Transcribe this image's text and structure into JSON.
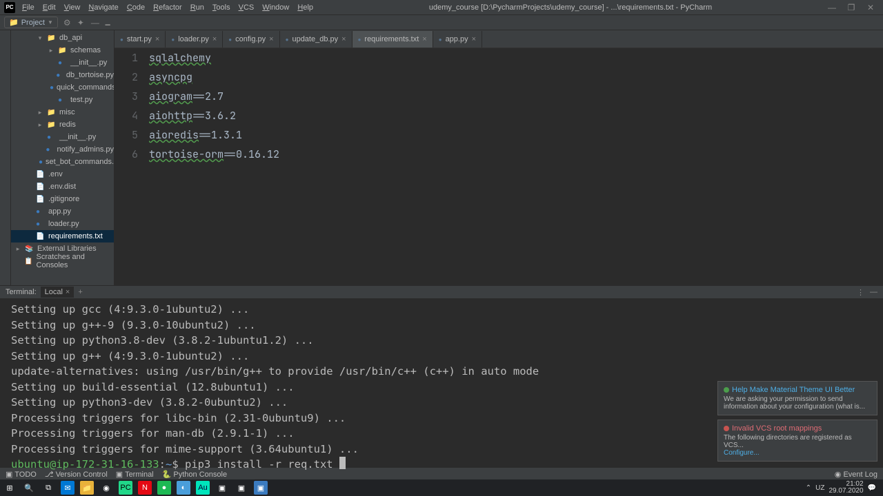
{
  "menu": [
    "File",
    "Edit",
    "View",
    "Navigate",
    "Code",
    "Refactor",
    "Run",
    "Tools",
    "VCS",
    "Window",
    "Help"
  ],
  "window_title": "udemy_course [D:\\PycharmProjects\\udemy_course] - ...\\requirements.txt - PyCharm",
  "project_button": "Project",
  "tabs": [
    {
      "label": "start.py",
      "active": false
    },
    {
      "label": "loader.py",
      "active": false
    },
    {
      "label": "config.py",
      "active": false
    },
    {
      "label": "update_db.py",
      "active": false
    },
    {
      "label": "requirements.txt",
      "active": true
    },
    {
      "label": "app.py",
      "active": false
    }
  ],
  "tree": [
    {
      "label": "db_api",
      "indent": 2,
      "arrow": "▾",
      "icon": "folder"
    },
    {
      "label": "schemas",
      "indent": 3,
      "arrow": "▸",
      "icon": "folder"
    },
    {
      "label": "__init__.py",
      "indent": 3,
      "arrow": "",
      "icon": "py"
    },
    {
      "label": "db_tortoise.py",
      "indent": 3,
      "arrow": "",
      "icon": "py"
    },
    {
      "label": "quick_commands.py",
      "indent": 3,
      "arrow": "",
      "icon": "py"
    },
    {
      "label": "test.py",
      "indent": 3,
      "arrow": "",
      "icon": "py"
    },
    {
      "label": "misc",
      "indent": 2,
      "arrow": "▸",
      "icon": "folder"
    },
    {
      "label": "redis",
      "indent": 2,
      "arrow": "▸",
      "icon": "folder"
    },
    {
      "label": "__init__.py",
      "indent": 2,
      "arrow": "",
      "icon": "py"
    },
    {
      "label": "notify_admins.py",
      "indent": 2,
      "arrow": "",
      "icon": "py"
    },
    {
      "label": "set_bot_commands.py",
      "indent": 2,
      "arrow": "",
      "icon": "py"
    },
    {
      "label": ".env",
      "indent": 1,
      "arrow": "",
      "icon": "txt"
    },
    {
      "label": ".env.dist",
      "indent": 1,
      "arrow": "",
      "icon": "txt"
    },
    {
      "label": ".gitignore",
      "indent": 1,
      "arrow": "",
      "icon": "txt"
    },
    {
      "label": "app.py",
      "indent": 1,
      "arrow": "",
      "icon": "py"
    },
    {
      "label": "loader.py",
      "indent": 1,
      "arrow": "",
      "icon": "py"
    },
    {
      "label": "requirements.txt",
      "indent": 1,
      "arrow": "",
      "icon": "txt",
      "selected": true
    },
    {
      "label": "External Libraries",
      "indent": 0,
      "arrow": "▸",
      "icon": "lib"
    },
    {
      "label": "Scratches and Consoles",
      "indent": 0,
      "arrow": "",
      "icon": "scratch"
    }
  ],
  "editor_lines": [
    "sqlalchemy",
    "asyncpg",
    "aiogram==2.7",
    "aiohttp==3.6.2",
    "aioredis==1.3.1",
    "tortoise-orm==0.16.12"
  ],
  "terminal": {
    "header_label": "Terminal:",
    "tab_label": "Local",
    "lines": [
      "Setting up gcc (4:9.3.0-1ubuntu2) ...",
      "Setting up g++-9 (9.3.0-10ubuntu2) ...",
      "Setting up python3.8-dev (3.8.2-1ubuntu1.2) ...",
      "Setting up g++ (4:9.3.0-1ubuntu2) ...",
      "update-alternatives: using /usr/bin/g++ to provide /usr/bin/c++ (c++) in auto mode",
      "Setting up build-essential (12.8ubuntu1) ...",
      "Setting up python3-dev (3.8.2-0ubuntu2) ...",
      "Processing triggers for libc-bin (2.31-0ubuntu9) ...",
      "Processing triggers for man-db (2.9.1-1) ...",
      "Processing triggers for mime-support (3.64ubuntu1) ..."
    ],
    "prompt_user": "ubuntu@ip-172-31-16-133",
    "prompt_sep": ":",
    "prompt_path": "~",
    "prompt_sym": "$",
    "command": "pip3 install -r req.txt "
  },
  "statusbar": {
    "items": [
      "TODO",
      "Version Control",
      "Terminal",
      "Python Console"
    ],
    "event_log": "Event Log"
  },
  "notifications": [
    {
      "type": "green",
      "title": "Help Make Material Theme UI Better",
      "body": "We are asking your permission to send information about your configuration (what is..."
    },
    {
      "type": "red",
      "title": "Invalid VCS root mappings",
      "body": "The following directories are registered as VCS...",
      "link": "Configure..."
    }
  ],
  "tray": {
    "time": "21:02",
    "date": "29.07.2020"
  }
}
